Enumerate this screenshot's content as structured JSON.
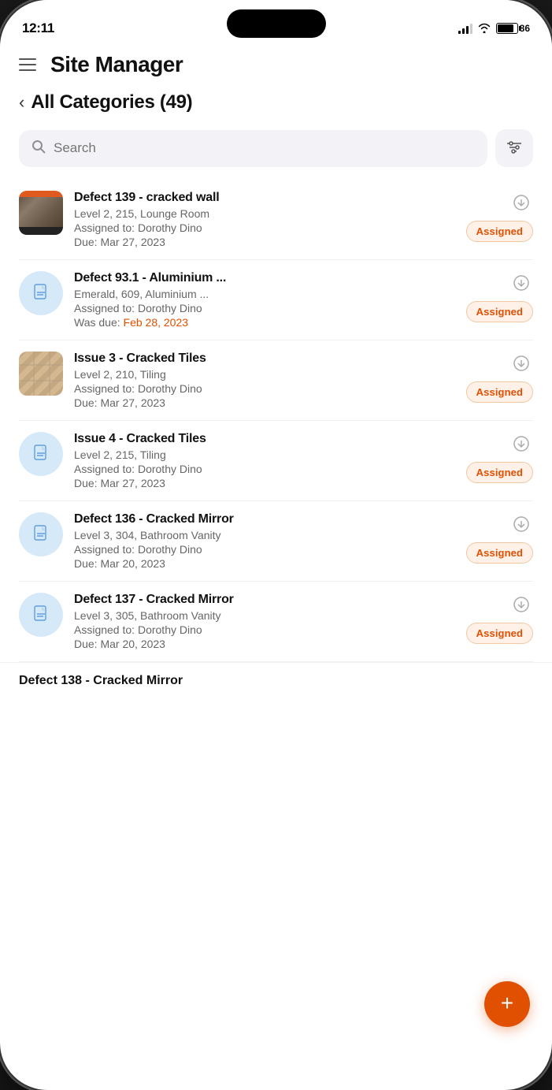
{
  "status_bar": {
    "time": "12:11",
    "battery_level": "86"
  },
  "header": {
    "title": "Site Manager",
    "menu_label": "menu"
  },
  "back_nav": {
    "label": "All Categories (49)",
    "count": 49
  },
  "search": {
    "placeholder": "Search",
    "filter_label": "filter"
  },
  "items": [
    {
      "id": 1,
      "title": "Defect 139 - cracked wall",
      "location": "Level 2, 215, Lounge Room",
      "assigned_label": "Assigned to:",
      "assigned_to": "Dorothy Dino",
      "due_label": "Due:",
      "due_date": "Mar 27, 2023",
      "due_overdue": false,
      "status": "Assigned",
      "thumbnail_type": "image"
    },
    {
      "id": 2,
      "title": "Defect 93.1 - Aluminium ...",
      "location": "Emerald, 609, Aluminium ...",
      "assigned_label": "Assigned to:",
      "assigned_to": "Dorothy Dino",
      "due_label": "Was due:",
      "due_date": "Feb 28, 2023",
      "due_overdue": true,
      "status": "Assigned",
      "thumbnail_type": "doc"
    },
    {
      "id": 3,
      "title": "Issue 3 - Cracked Tiles",
      "location": "Level 2, 210, Tiling",
      "assigned_label": "Assigned to:",
      "assigned_to": "Dorothy Dino",
      "due_label": "Due:",
      "due_date": "Mar 27, 2023",
      "due_overdue": false,
      "status": "Assigned",
      "thumbnail_type": "tiles"
    },
    {
      "id": 4,
      "title": "Issue 4 - Cracked Tiles",
      "location": "Level 2, 215, Tiling",
      "assigned_label": "Assigned to:",
      "assigned_to": "Dorothy Dino",
      "due_label": "Due:",
      "due_date": "Mar 27, 2023",
      "due_overdue": false,
      "status": "Assigned",
      "thumbnail_type": "doc"
    },
    {
      "id": 5,
      "title": "Defect 136 - Cracked Mirror",
      "location": "Level 3, 304, Bathroom Vanity",
      "assigned_label": "Assigned to:",
      "assigned_to": "Dorothy Dino",
      "due_label": "Due:",
      "due_date": "Mar 20, 2023",
      "due_overdue": false,
      "status": "Assigned",
      "thumbnail_type": "doc"
    },
    {
      "id": 6,
      "title": "Defect 137 - Cracked Mirror",
      "location": "Level 3, 305, Bathroom Vanity",
      "assigned_label": "Assigned to:",
      "assigned_to": "Dorothy Dino",
      "due_label": "Due:",
      "due_date": "Mar 20, 2023",
      "due_overdue": false,
      "status": "Assigned",
      "thumbnail_type": "doc"
    }
  ],
  "partial_item": {
    "title": "Defect 138 - Cracked Mirror"
  },
  "fab": {
    "label": "+"
  },
  "colors": {
    "accent": "#e05000",
    "badge_bg": "#fff0e8",
    "badge_text": "#e05000",
    "doc_bg": "#d6e9f8",
    "doc_icon": "#4a90d9"
  }
}
